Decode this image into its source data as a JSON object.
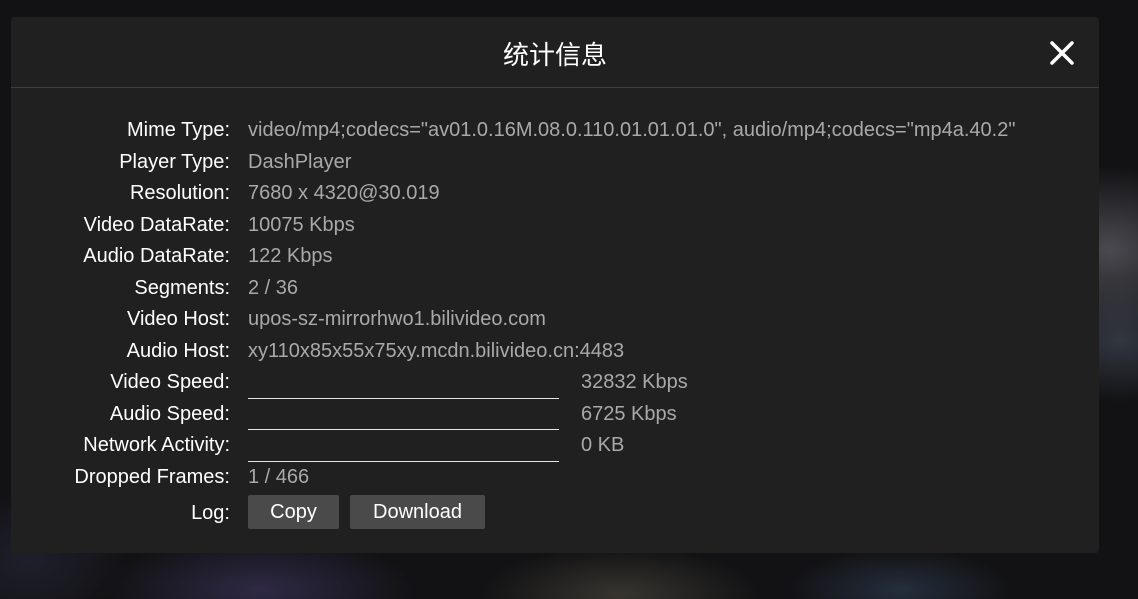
{
  "dialog": {
    "title": "统计信息"
  },
  "stats": {
    "mime_type": {
      "label": "Mime Type:",
      "value": "video/mp4;codecs=\"av01.0.16M.08.0.110.01.01.01.0\", audio/mp4;codecs=\"mp4a.40.2\""
    },
    "player_type": {
      "label": "Player Type:",
      "value": "DashPlayer"
    },
    "resolution": {
      "label": "Resolution:",
      "value": "7680 x 4320@30.019"
    },
    "video_datarate": {
      "label": "Video DataRate:",
      "value": "10075 Kbps"
    },
    "audio_datarate": {
      "label": "Audio DataRate:",
      "value": "122 Kbps"
    },
    "segments": {
      "label": "Segments:",
      "value": "2 / 36"
    },
    "video_host": {
      "label": "Video Host:",
      "value": "upos-sz-mirrorhwo1.bilivideo.com"
    },
    "audio_host": {
      "label": "Audio Host:",
      "value": "xy110x85x55x75xy.mcdn.bilivideo.cn:4483"
    },
    "video_speed": {
      "label": "Video Speed:",
      "value": "32832 Kbps"
    },
    "audio_speed": {
      "label": "Audio Speed:",
      "value": "6725 Kbps"
    },
    "network_activity": {
      "label": "Network Activity:",
      "value": "0 KB"
    },
    "dropped_frames": {
      "label": "Dropped Frames:",
      "value": "1 / 466"
    },
    "log": {
      "label": "Log:",
      "copy_label": "Copy",
      "download_label": "Download"
    }
  },
  "icons": {
    "close": "close-icon"
  },
  "colors": {
    "panel_bg": "#202020",
    "label": "#ffffff",
    "value": "#a9a9a9",
    "button_bg": "#4a4a4a"
  }
}
